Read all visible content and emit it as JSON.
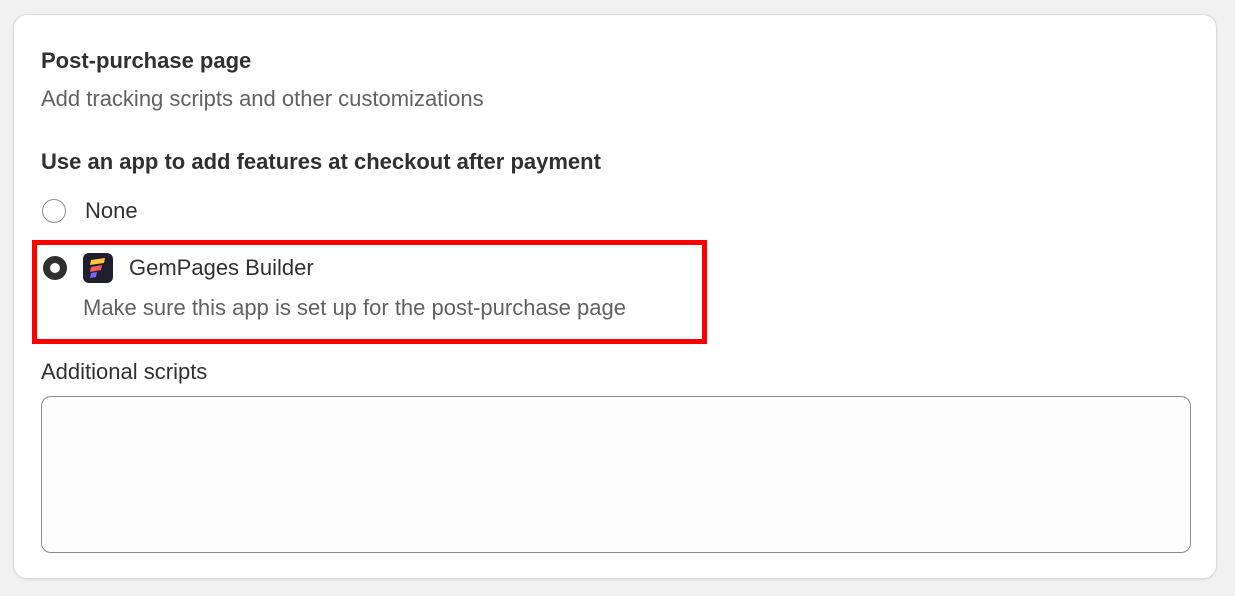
{
  "section": {
    "title": "Post-purchase page",
    "subtitle": "Add tracking scripts and other customizations"
  },
  "app_choice": {
    "label": "Use an app to add features at checkout after payment",
    "options": [
      {
        "label": "None",
        "selected": false
      },
      {
        "label": "GemPages Builder",
        "selected": true,
        "icon": "gempages-app-icon",
        "help": "Make sure this app is set up for the post-purchase page"
      }
    ]
  },
  "additional_scripts": {
    "label": "Additional scripts",
    "value": ""
  },
  "highlight_color": "#ff0000"
}
